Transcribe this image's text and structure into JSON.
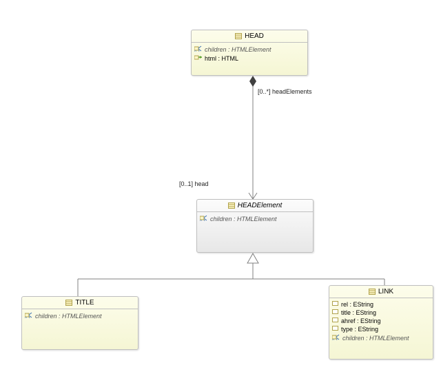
{
  "classes": {
    "head": {
      "name": "HEAD",
      "attrs": [
        {
          "icon": "ref",
          "text": "children : HTMLElement",
          "italic": true
        },
        {
          "icon": "op",
          "text": "html : HTML"
        }
      ]
    },
    "headelement": {
      "name": "HEADElement",
      "attrs": [
        {
          "icon": "ref",
          "text": "children : HTMLElement",
          "italic": true
        }
      ]
    },
    "title": {
      "name": "TITLE",
      "attrs": [
        {
          "icon": "ref",
          "text": "children : HTMLElement",
          "italic": true
        }
      ]
    },
    "link": {
      "name": "LINK",
      "attrs": [
        {
          "icon": "attr",
          "text": "rel : EString"
        },
        {
          "icon": "attr",
          "text": "title : EString"
        },
        {
          "icon": "attr",
          "text": "ahref : EString"
        },
        {
          "icon": "attr",
          "text": "type : EString"
        },
        {
          "icon": "ref",
          "text": "children : HTMLElement",
          "italic": true
        }
      ]
    }
  },
  "labels": {
    "headElements": "[0..*] headElements",
    "head": "[0..1] head"
  }
}
